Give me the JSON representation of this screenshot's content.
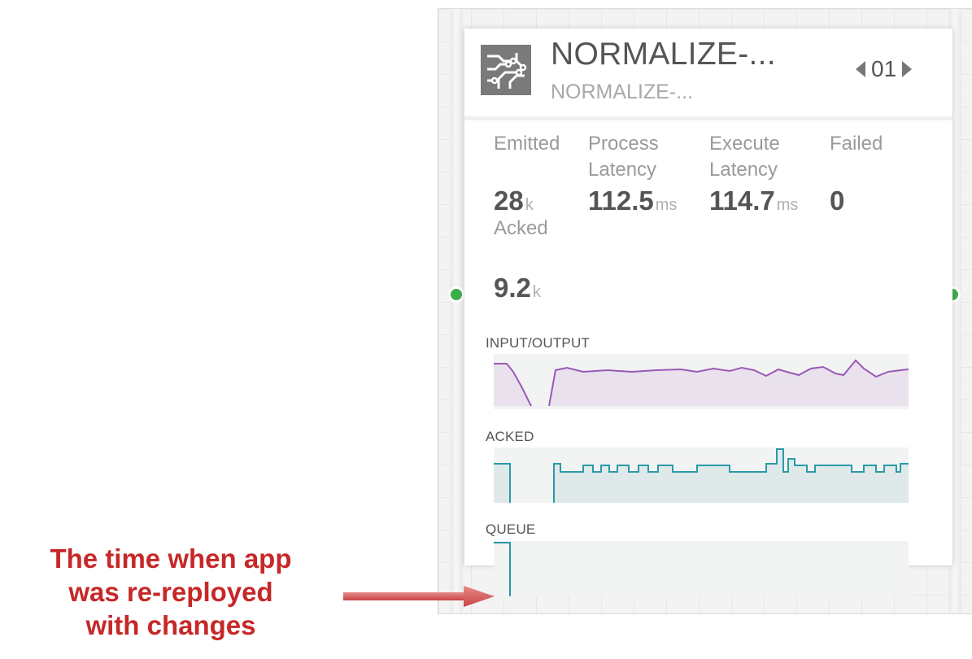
{
  "node": {
    "title": "NORMALIZE-...",
    "subtitle": "NORMALIZE-...",
    "instance": "01",
    "icon": "processor-circuit-icon"
  },
  "metrics": {
    "emitted": {
      "label": "Emitted",
      "value": "28",
      "unit": "k"
    },
    "process_latency": {
      "label_line1": "Process",
      "label_line2": "Latency",
      "value": "112.5",
      "unit": "ms"
    },
    "execute_latency": {
      "label_line1": "Execute",
      "label_line2": "Latency",
      "value": "114.7",
      "unit": "ms"
    },
    "failed": {
      "label": "Failed",
      "value": "0"
    },
    "acked": {
      "label": "Acked",
      "value": "9.2",
      "unit": "k"
    }
  },
  "sections": {
    "input_output": "INPUT/OUTPUT",
    "acked": "ACKED",
    "queue": "QUEUE"
  },
  "colors": {
    "io_line": "#9b59b6",
    "io_fill": "#e9e2ec",
    "acked_line": "#2a9aa8",
    "acked_fill": "#dfe9e9",
    "queue_line": "#2a9aa8",
    "port": "#3cae49",
    "annotation": "#c62828"
  },
  "annotation": {
    "line1": "The time when app",
    "line2": "was re-reployed",
    "line3": "with changes"
  }
}
